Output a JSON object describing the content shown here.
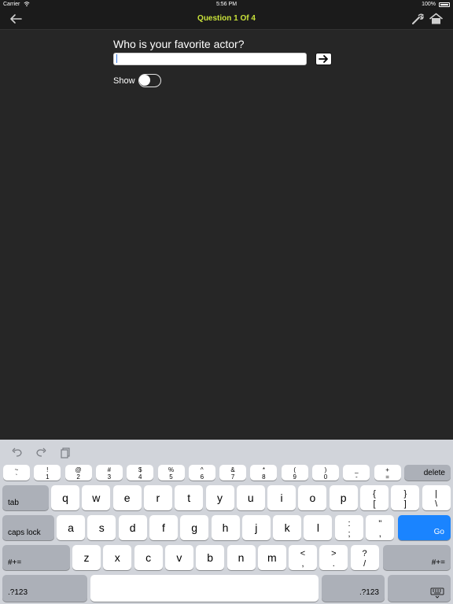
{
  "status_bar": {
    "carrier": "Carrier",
    "time": "5:56 PM",
    "battery": "100%"
  },
  "nav": {
    "title": "Question 1 Of 4",
    "back_icon": "back-arrow-icon",
    "settings_icon": "wrench-icon",
    "home_icon": "home-icon"
  },
  "question": {
    "text": "Who is your favorite actor?",
    "answer_value": "",
    "show_label": "Show",
    "show_on": false,
    "accent": "#c9e23a"
  },
  "keyboard": {
    "go_color": "#1a84ff",
    "row1": [
      {
        "top": "~",
        "bot": "`"
      },
      {
        "top": "!",
        "bot": "1"
      },
      {
        "top": "@",
        "bot": "2"
      },
      {
        "top": "#",
        "bot": "3"
      },
      {
        "top": "$",
        "bot": "4"
      },
      {
        "top": "%",
        "bot": "5"
      },
      {
        "top": "^",
        "bot": "6"
      },
      {
        "top": "&",
        "bot": "7"
      },
      {
        "top": "*",
        "bot": "8"
      },
      {
        "top": "(",
        "bot": "9"
      },
      {
        "top": ")",
        "bot": "0"
      },
      {
        "top": "_",
        "bot": "-"
      },
      {
        "top": "+",
        "bot": "="
      }
    ],
    "delete": "delete",
    "tab": "tab",
    "row2": [
      "q",
      "w",
      "e",
      "r",
      "t",
      "y",
      "u",
      "i",
      "o",
      "p"
    ],
    "row2_sym": [
      {
        "top": "{",
        "bot": "["
      },
      {
        "top": "}",
        "bot": "]"
      },
      {
        "top": "|",
        "bot": "\\"
      }
    ],
    "caps": "caps lock",
    "row3": [
      "a",
      "s",
      "d",
      "f",
      "g",
      "h",
      "j",
      "k",
      "l"
    ],
    "row3_sym": [
      {
        "top": ":",
        "bot": ";"
      },
      {
        "top": "\"",
        "bot": ","
      }
    ],
    "go": "Go",
    "shift_left": "#+=",
    "row4": [
      "z",
      "x",
      "c",
      "v",
      "b",
      "n",
      "m"
    ],
    "row4_sym": [
      {
        "top": "<",
        "bot": ","
      },
      {
        "top": ">",
        "bot": "."
      },
      {
        "top": "?",
        "bot": "/"
      }
    ],
    "shift_right": "#+=",
    "num_left": ".?123",
    "num_right": ".?123"
  }
}
